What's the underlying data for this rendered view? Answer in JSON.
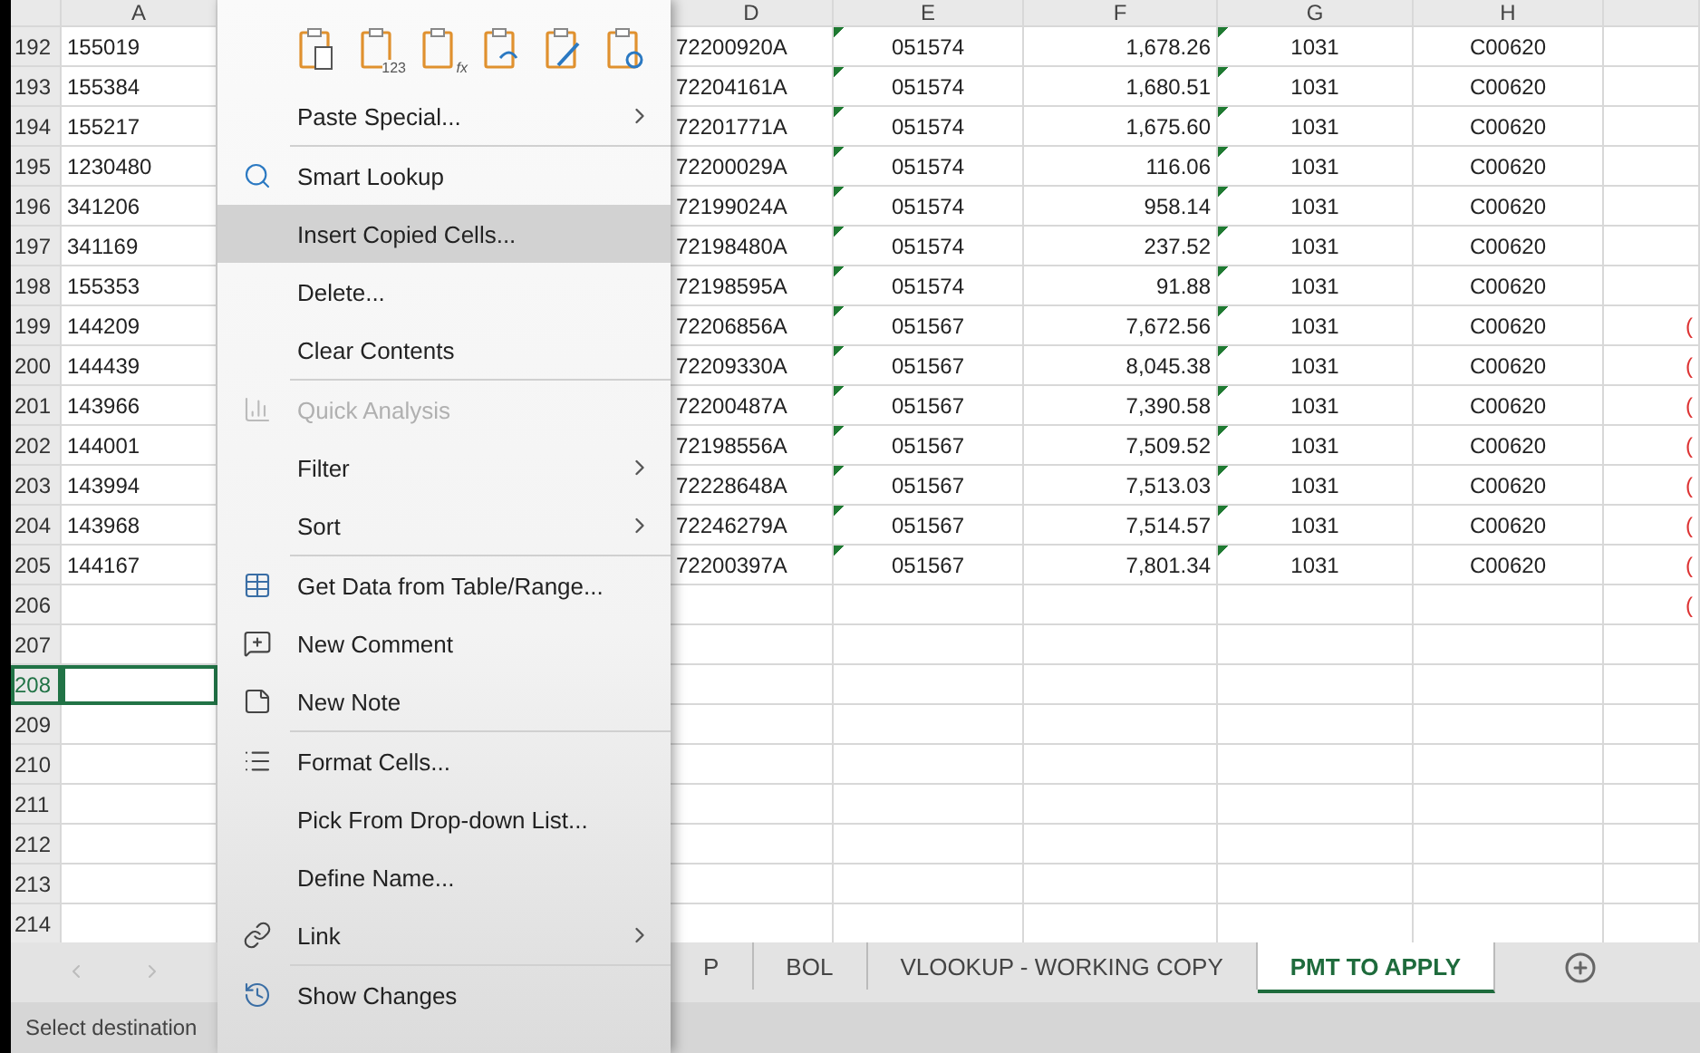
{
  "sheet": {
    "columns": [
      "A",
      "D",
      "E",
      "F",
      "G",
      "H"
    ],
    "rows": [
      {
        "row": "192",
        "a": "155019",
        "d": "72200920A",
        "e": "051574",
        "f": "1,678.26",
        "g": "1031",
        "h": "C00620",
        "flagged": true
      },
      {
        "row": "193",
        "a": "155384",
        "d": "72204161A",
        "e": "051574",
        "f": "1,680.51",
        "g": "1031",
        "h": "C00620",
        "flagged": true
      },
      {
        "row": "194",
        "a": "155217",
        "d": "72201771A",
        "e": "051574",
        "f": "1,675.60",
        "g": "1031",
        "h": "C00620",
        "flagged": true
      },
      {
        "row": "195",
        "a": "1230480",
        "d": "72200029A",
        "e": "051574",
        "f": "116.06",
        "g": "1031",
        "h": "C00620",
        "flagged": true
      },
      {
        "row": "196",
        "a": "341206",
        "d": "72199024A",
        "e": "051574",
        "f": "958.14",
        "g": "1031",
        "h": "C00620",
        "flagged": true
      },
      {
        "row": "197",
        "a": "341169",
        "d": "72198480A",
        "e": "051574",
        "f": "237.52",
        "g": "1031",
        "h": "C00620",
        "flagged": true
      },
      {
        "row": "198",
        "a": "155353",
        "d": "72198595A",
        "e": "051574",
        "f": "91.88",
        "g": "1031",
        "h": "C00620",
        "flagged": true
      },
      {
        "row": "199",
        "a": "144209",
        "d": "72206856A",
        "e": "051567",
        "f": "7,672.56",
        "g": "1031",
        "h": "C00620",
        "flagged": true,
        "i": "("
      },
      {
        "row": "200",
        "a": "144439",
        "d": "72209330A",
        "e": "051567",
        "f": "8,045.38",
        "g": "1031",
        "h": "C00620",
        "flagged": true,
        "i": "("
      },
      {
        "row": "201",
        "a": "143966",
        "d": "72200487A",
        "e": "051567",
        "f": "7,390.58",
        "g": "1031",
        "h": "C00620",
        "flagged": true,
        "i": "("
      },
      {
        "row": "202",
        "a": "144001",
        "d": "72198556A",
        "e": "051567",
        "f": "7,509.52",
        "g": "1031",
        "h": "C00620",
        "flagged": true,
        "i": "("
      },
      {
        "row": "203",
        "a": "143994",
        "d": "72228648A",
        "e": "051567",
        "f": "7,513.03",
        "g": "1031",
        "h": "C00620",
        "flagged": true,
        "i": "("
      },
      {
        "row": "204",
        "a": "143968",
        "d": "72246279A",
        "e": "051567",
        "f": "7,514.57",
        "g": "1031",
        "h": "C00620",
        "flagged": true,
        "i": "("
      },
      {
        "row": "205",
        "a": "144167",
        "d": "72200397A",
        "e": "051567",
        "f": "7,801.34",
        "g": "1031",
        "h": "C00620",
        "flagged": true,
        "i": "("
      },
      {
        "row": "206",
        "i": "("
      },
      {
        "row": "207",
        "selected": false
      },
      {
        "row": "208",
        "selected": true
      },
      {
        "row": "209",
        "selected": false
      },
      {
        "row": "210",
        "selected": false
      },
      {
        "row": "211",
        "selected": false
      },
      {
        "row": "212",
        "selected": false
      },
      {
        "row": "213",
        "selected": false
      },
      {
        "row": "214",
        "selected": false
      }
    ]
  },
  "context_menu": {
    "paste_options": [
      {
        "kind": "paste"
      },
      {
        "kind": "values",
        "label": "123"
      },
      {
        "kind": "formulas",
        "label": "fx"
      },
      {
        "kind": "transpose"
      },
      {
        "kind": "formatting"
      },
      {
        "kind": "link"
      }
    ],
    "items": [
      {
        "label": "Paste Special...",
        "kind": "plain",
        "submenu": true,
        "disabled": false,
        "highlighted": false
      },
      {
        "kind": "separator"
      },
      {
        "label": "Smart Lookup",
        "kind": "lookup",
        "submenu": false,
        "disabled": false,
        "highlighted": false
      },
      {
        "label": "Insert Copied Cells...",
        "kind": "plain",
        "submenu": false,
        "disabled": false,
        "highlighted": true
      },
      {
        "label": "Delete...",
        "kind": "plain",
        "submenu": false,
        "disabled": false,
        "highlighted": false
      },
      {
        "label": "Clear Contents",
        "kind": "plain",
        "submenu": false,
        "disabled": false,
        "highlighted": false
      },
      {
        "kind": "separator"
      },
      {
        "label": "Quick Analysis",
        "kind": "analysis",
        "submenu": false,
        "disabled": true,
        "highlighted": false
      },
      {
        "label": "Filter",
        "kind": "plain",
        "submenu": true,
        "disabled": false,
        "highlighted": false
      },
      {
        "label": "Sort",
        "kind": "plain",
        "submenu": true,
        "disabled": false,
        "highlighted": false
      },
      {
        "kind": "separator"
      },
      {
        "label": "Get Data from Table/Range...",
        "kind": "table",
        "submenu": false,
        "disabled": false,
        "highlighted": false
      },
      {
        "label": "New Comment",
        "kind": "comment",
        "submenu": false,
        "disabled": false,
        "highlighted": false
      },
      {
        "label": "New Note",
        "kind": "note",
        "submenu": false,
        "disabled": false,
        "highlighted": false
      },
      {
        "kind": "separator"
      },
      {
        "label": "Format Cells...",
        "kind": "format",
        "submenu": false,
        "disabled": false,
        "highlighted": false
      },
      {
        "label": "Pick From Drop-down List...",
        "kind": "plain",
        "submenu": false,
        "disabled": false,
        "highlighted": false
      },
      {
        "label": "Define Name...",
        "kind": "plain",
        "submenu": false,
        "disabled": false,
        "highlighted": false
      },
      {
        "label": "Link",
        "kind": "link",
        "submenu": true,
        "disabled": false,
        "highlighted": false
      },
      {
        "kind": "separator"
      },
      {
        "label": "Show Changes",
        "kind": "changes",
        "submenu": false,
        "disabled": false,
        "highlighted": false
      }
    ]
  },
  "sheet_tabs": [
    {
      "label": "P",
      "selected": false
    },
    {
      "label": "BOL",
      "selected": false
    },
    {
      "label": "VLOOKUP - WORKING COPY",
      "selected": false
    },
    {
      "label": "PMT TO APPLY",
      "selected": true
    }
  ],
  "status_bar": {
    "message": "Select destination"
  }
}
